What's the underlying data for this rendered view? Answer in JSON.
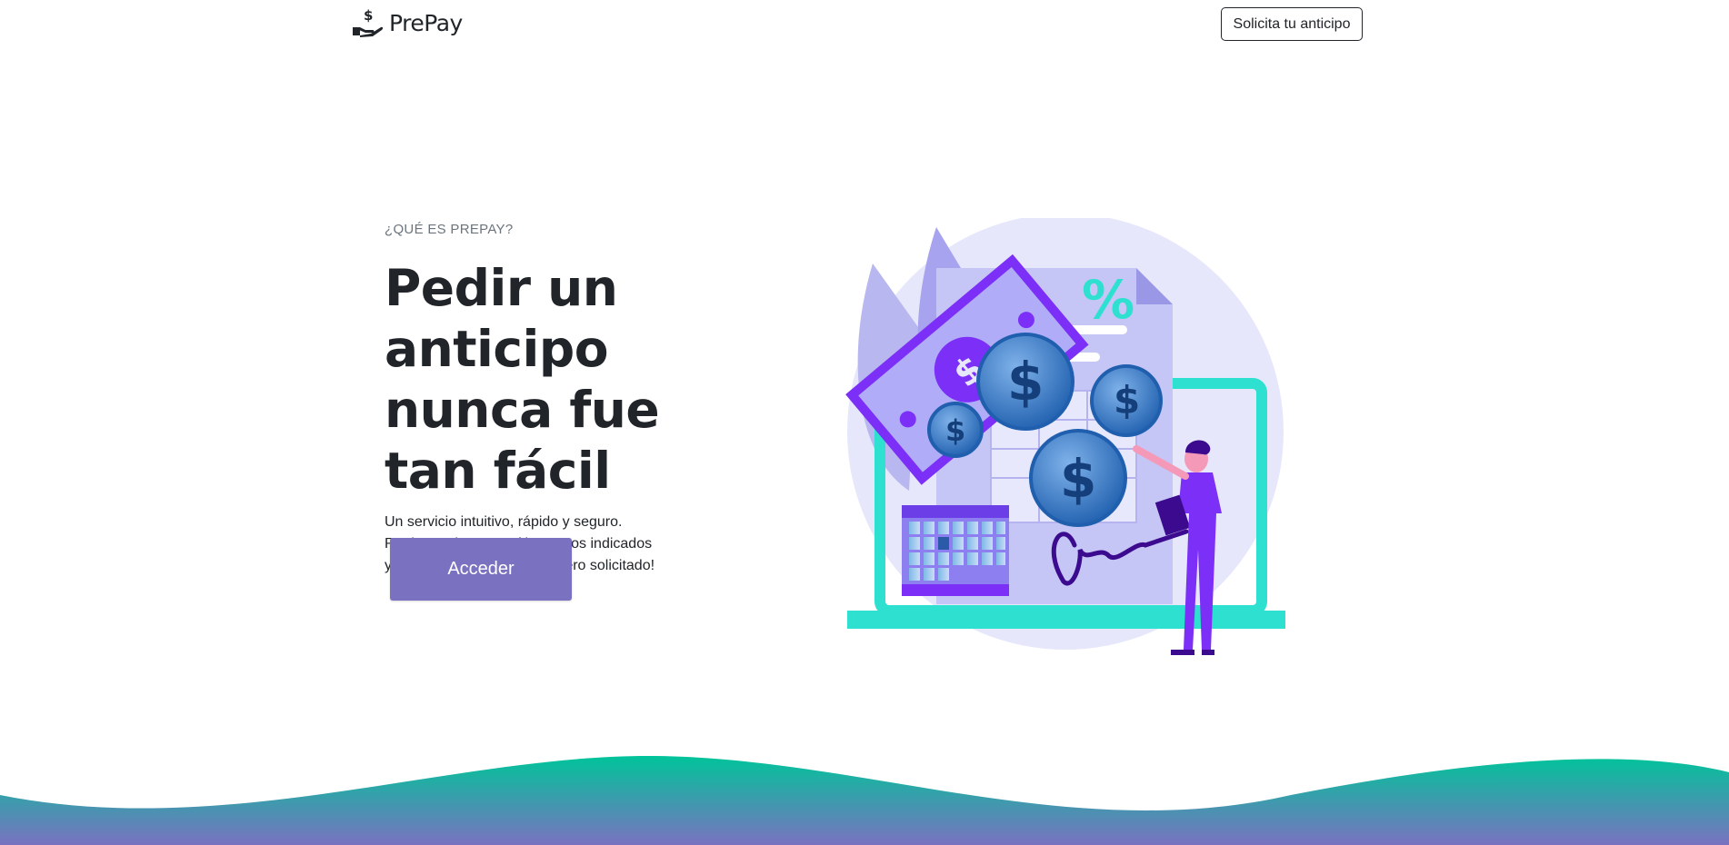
{
  "header": {
    "brand_name": "PrePay",
    "brand_icon": "hand-dollar-icon",
    "cta_label": "Solicita tu anticipo"
  },
  "hero": {
    "eyebrow": "¿QUÉ ES PREPAY?",
    "headline": "Pedir un anticipo nunca fue tan fácil",
    "description_lines": [
      "Un servicio intuitivo, rápido y seguro.",
      "Registrate hoy, seguí los pasos indicados",
      "y en minutos recibirás el dinero solicitado!"
    ],
    "primary_button": "Acceder"
  },
  "colors": {
    "accent": "#7a72c0",
    "wave_top": "#00c49a",
    "wave_bottom": "#7a72c0",
    "illustration_purple": "#7b2ff7",
    "illustration_teal": "#2ee0cf"
  }
}
